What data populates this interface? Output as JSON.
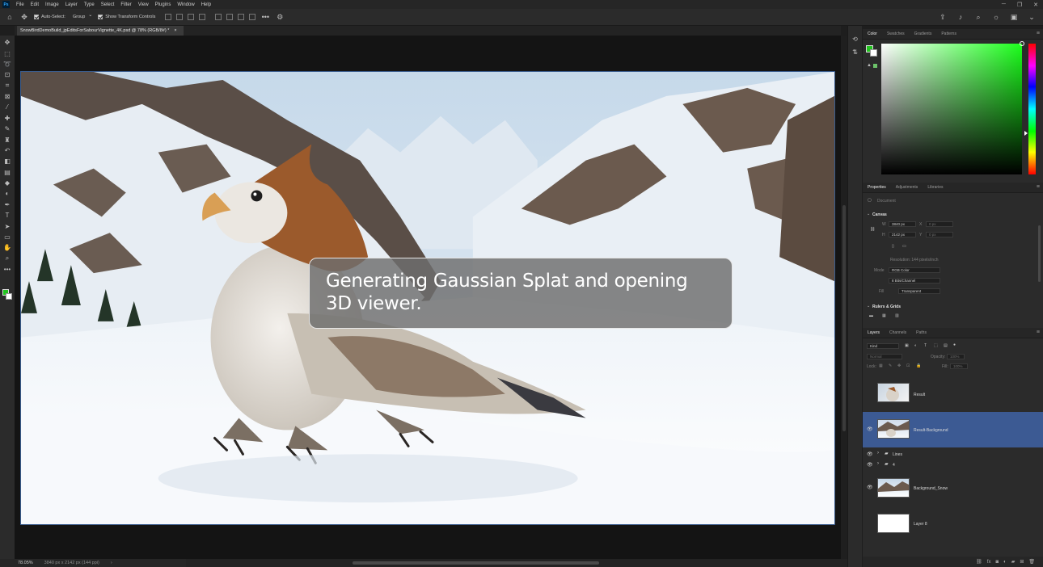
{
  "app": {
    "menu": [
      "File",
      "Edit",
      "Image",
      "Layer",
      "Type",
      "Select",
      "Filter",
      "View",
      "Plugins",
      "Window",
      "Help"
    ],
    "logo_text": "Ps",
    "window_controls": [
      "─",
      "❐",
      "✕"
    ]
  },
  "options_bar": {
    "auto_select_label": "Auto-Select:",
    "auto_select_target": "Group",
    "show_transform_label": "Show Transform Controls",
    "more_label": "•••"
  },
  "document": {
    "tab_title": "SnowBirdDemoBuild_jpEditsForSabourVignette_4K.psd @ 78% (RGB/8#) *",
    "tab_close": "×"
  },
  "overlay": {
    "message": "Generating Gaussian Splat and opening 3D viewer."
  },
  "status": {
    "zoom": "78.05%",
    "doc_info": "3840 px x 2142 px (144 ppi)",
    "arrow": "›"
  },
  "colors": {
    "foreground": "#22c41f",
    "background": "#ffffff",
    "selection": "#3c5a93"
  },
  "color_panel": {
    "tabs": [
      "Color",
      "Swatches",
      "Gradients",
      "Patterns"
    ],
    "active_tab": "Color"
  },
  "properties_panel": {
    "tabs": [
      "Properties",
      "Adjustments",
      "Libraries"
    ],
    "active_tab": "Properties",
    "type_label": "Document",
    "canvas_section": "Canvas",
    "width_label": "W",
    "width_value": "3840 px",
    "height_label": "H",
    "height_value": "2142 px",
    "x_label": "X",
    "x_value": "0 px",
    "y_label": "Y",
    "y_value": "0 px",
    "resolution": "Resolution: 144 pixels/inch",
    "mode_label": "Mode",
    "mode_value": "RGB Color",
    "depth_value": "8 Bits/Channel",
    "fill_label": "Fill",
    "fill_value": "Transparent",
    "rulers_section": "Rulers & Grids"
  },
  "layers_panel": {
    "tabs": [
      "Layers",
      "Channels",
      "Paths"
    ],
    "active_tab": "Layers",
    "filter_kind": "Kind",
    "blend_mode": "Normal",
    "opacity_label": "Opacity:",
    "opacity_value": "100%",
    "lock_label": "Lock:",
    "fill_label": "Fill:",
    "fill_value": "100%",
    "layers": [
      {
        "name": "Result",
        "kind": "image",
        "visible": false,
        "selected": false
      },
      {
        "name": "Result-Background",
        "kind": "image",
        "visible": true,
        "selected": true
      },
      {
        "name": "Lines",
        "kind": "group",
        "visible": true,
        "selected": false
      },
      {
        "name": "4",
        "kind": "group",
        "visible": true,
        "selected": false
      },
      {
        "name": "Background_Snow",
        "kind": "image",
        "visible": true,
        "selected": false
      },
      {
        "name": "Layer 8",
        "kind": "white",
        "visible": false,
        "selected": false
      }
    ]
  }
}
